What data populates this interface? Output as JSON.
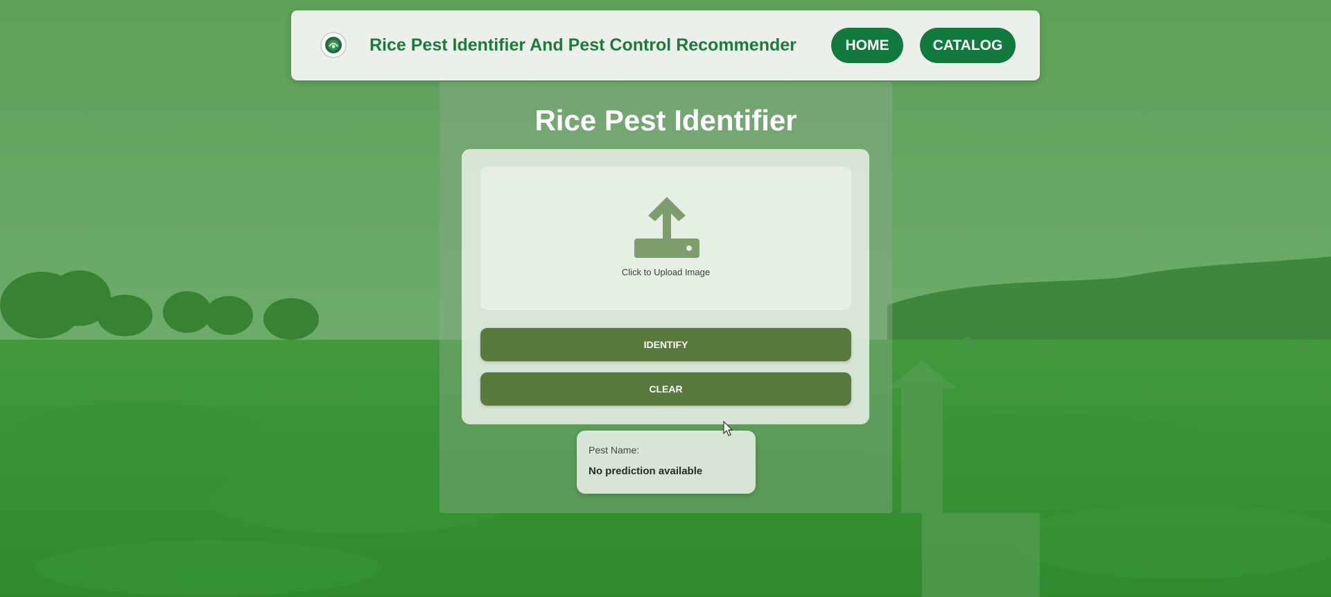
{
  "navbar": {
    "title": "Rice Pest Identifier And Pest Control Recommender",
    "logo_icon": "rice-pest-logo-icon",
    "home_label": "HOME",
    "catalog_label": "CATALOG"
  },
  "main": {
    "title": "Rice Pest Identifier",
    "upload": {
      "icon": "upload-icon",
      "label": "Click to Upload Image"
    },
    "identify_label": "IDENTIFY",
    "clear_label": "CLEAR",
    "result": {
      "label": "Pest Name:",
      "value": "No prediction available"
    }
  },
  "colors": {
    "brand_green": "#117a3c",
    "title_green": "#1d7a3a",
    "button_olive": "#587a3e",
    "overlay_green": "#1a8c28"
  }
}
